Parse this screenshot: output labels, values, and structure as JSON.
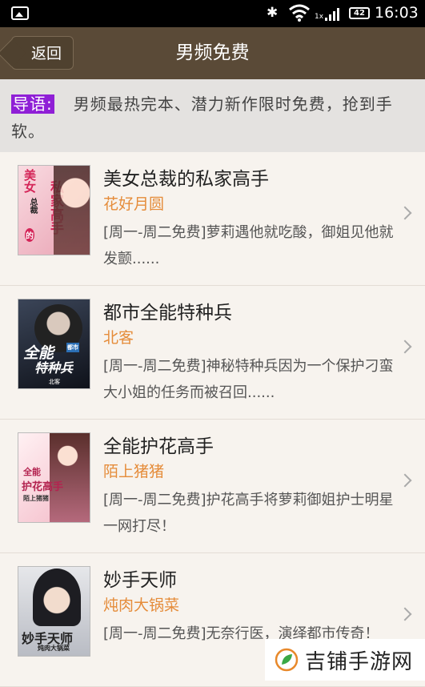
{
  "status_bar": {
    "time": "16:03",
    "battery": "42",
    "network": "1x"
  },
  "header": {
    "back_label": "返回",
    "title": "男频免费"
  },
  "intro": {
    "tag": "导语:",
    "text": "男频最热完本、潜力新作限时免费，抢到手软。"
  },
  "books": [
    {
      "title": "美女总裁的私家高手",
      "author": "花好月圆",
      "description": "[周一-周二免费]萝莉遇他就吃酸，御姐见他就发颤......",
      "cover_text": [
        "美女",
        "总裁",
        "的",
        "私家高手"
      ],
      "cover_colors": [
        "#f4c7cf",
        "#e25b7a"
      ]
    },
    {
      "title": "都市全能特种兵",
      "author": "北客",
      "description": "[周一-周二免费]神秘特种兵因为一个保护刁蛮大小姐的任务而被召回......",
      "cover_text": [
        "全能",
        "特种兵",
        "都市",
        "北客"
      ],
      "cover_colors": [
        "#1a1f2c",
        "#56647a"
      ]
    },
    {
      "title": "全能护花高手",
      "author": "陌上猪猪",
      "description": "[周一-周二免费]护花高手将萝莉御姐护士明星一网打尽！",
      "cover_text": [
        "全能",
        "护花高手",
        "陌上猪猪"
      ],
      "cover_colors": [
        "#fbe7ea",
        "#c74a67"
      ]
    },
    {
      "title": "妙手天师",
      "author": "炖肉大锅菜",
      "description": "[周一-周二免费]无奈行医，演绎都市传奇！",
      "cover_text": [
        "妙手天师",
        "炖肉大锅菜"
      ],
      "cover_colors": [
        "#d8d9dc",
        "#3c3f4a"
      ]
    }
  ],
  "watermark": {
    "text": "吉铺手游网"
  }
}
